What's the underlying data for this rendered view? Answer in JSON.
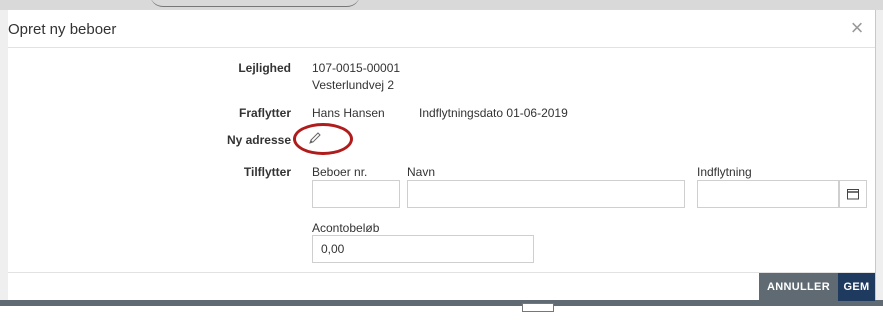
{
  "modal": {
    "title": "Opret ny beboer",
    "close_symbol": "×",
    "close_icon": "close-icon"
  },
  "form": {
    "lejlighed": {
      "label": "Lejlighed",
      "number": "107-0015-00001",
      "address": "Vesterlundvej 2"
    },
    "fraflytter": {
      "label": "Fraflytter",
      "name": "Hans Hansen",
      "move_in": "Indflytningsdato 01-06-2019"
    },
    "ny_adresse": {
      "label": "Ny adresse",
      "icon": "pencil-icon"
    },
    "tilflytter": {
      "label": "Tilflytter",
      "beboer_nr_label": "Beboer nr.",
      "beboer_nr_value": "",
      "navn_label": "Navn",
      "navn_value": "",
      "indflytning_label": "Indflytning",
      "indflytning_value": "",
      "calendar_icon": "calendar-icon",
      "acontobelob_label": "Acontobeløb",
      "acontobelob_value": "0,00"
    }
  },
  "footer": {
    "cancel_label": "ANNULLER",
    "save_label": "GEM"
  },
  "colors": {
    "highlight": "#b01c1c",
    "cancel_bg": "#5f6a72",
    "save_bg": "#1f3a5f"
  }
}
